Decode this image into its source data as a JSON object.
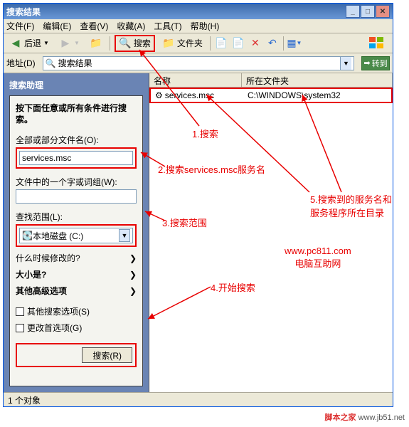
{
  "window": {
    "title": "搜索结果"
  },
  "menubar": {
    "file": "文件(F)",
    "edit": "编辑(E)",
    "view": "查看(V)",
    "fav": "收藏(A)",
    "tools": "工具(T)",
    "help": "帮助(H)"
  },
  "toolbar": {
    "back": "后退",
    "search": "搜索",
    "folders": "文件夹"
  },
  "address": {
    "label": "地址(D)",
    "value": "搜索结果",
    "go": "转到"
  },
  "side": {
    "title": "搜索助理",
    "heading": "按下面任意或所有条件进行搜索。",
    "filename_label": "全部或部分文件名(O):",
    "filename_value": "services.msc",
    "phrase_label": "文件中的一个字或词组(W):",
    "phrase_value": "",
    "scope_label": "查找范围(L):",
    "scope_value": "本地磁盘 (C:)",
    "modified": "什么时候修改的?",
    "size": "大小是?",
    "advanced": "其他高级选项",
    "other_opts": "其他搜索选项(S)",
    "prefs": "更改首选项(G)",
    "search_btn": "搜索(R)"
  },
  "results": {
    "col_name": "名称",
    "col_folder": "所在文件夹",
    "rows": [
      {
        "name": "services.msc",
        "folder": "C:\\WINDOWS\\system32"
      }
    ]
  },
  "status": "1 个对象",
  "annotations": {
    "a1": "1.搜索",
    "a2": "2.搜索services.msc服务名",
    "a3": "3.搜索范围",
    "a4": "4.开始搜索",
    "a5": "5.搜索到的服务名和服务程序所在目录",
    "site1": "www.pc811.com",
    "site2": "电脑互助网",
    "footer1": "脚本之家",
    "footer2": "www.jb51.net"
  }
}
